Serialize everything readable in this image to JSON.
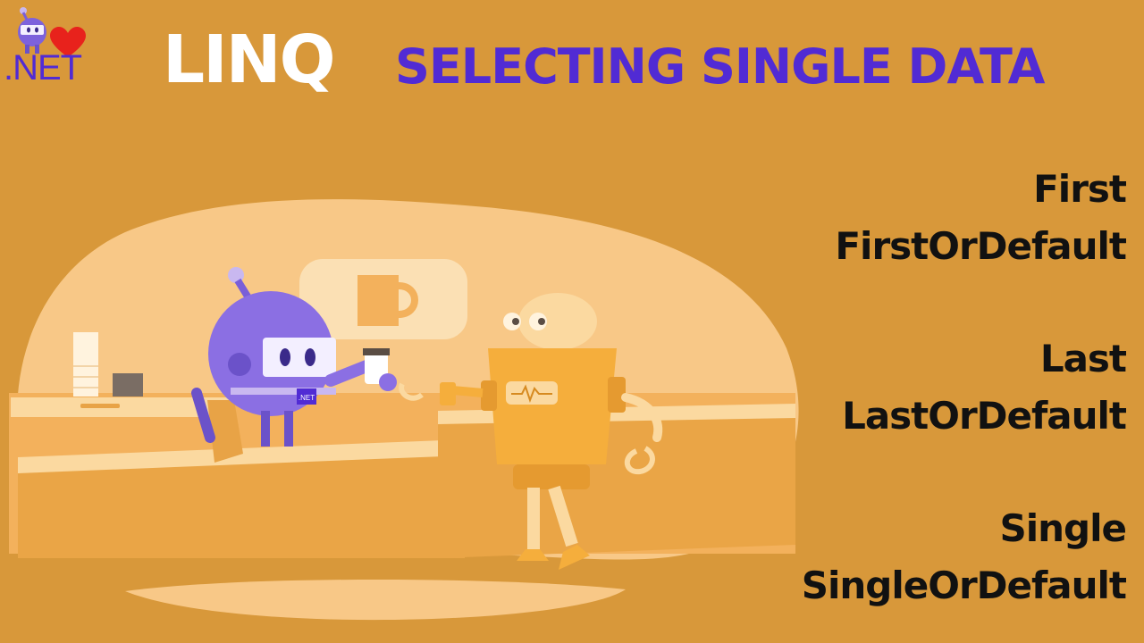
{
  "logo": {
    "text": ".NET",
    "icon": "dotnet-bot-heart-logo"
  },
  "header": {
    "title": "LINQ",
    "subtitle": "SELECTING SINGLE DATA"
  },
  "illustration": {
    "badge_text": ".NET",
    "icon": "robots-coffee-shop-illustration"
  },
  "methods": {
    "group1": [
      "First",
      "FirstOrDefault"
    ],
    "group2": [
      "Last",
      "LastOrDefault"
    ],
    "group3": [
      "Single",
      "SingleOrDefault"
    ]
  },
  "colors": {
    "background": "#d8983a",
    "accent": "#512bd4",
    "title": "#ffffff",
    "text": "#111111"
  }
}
